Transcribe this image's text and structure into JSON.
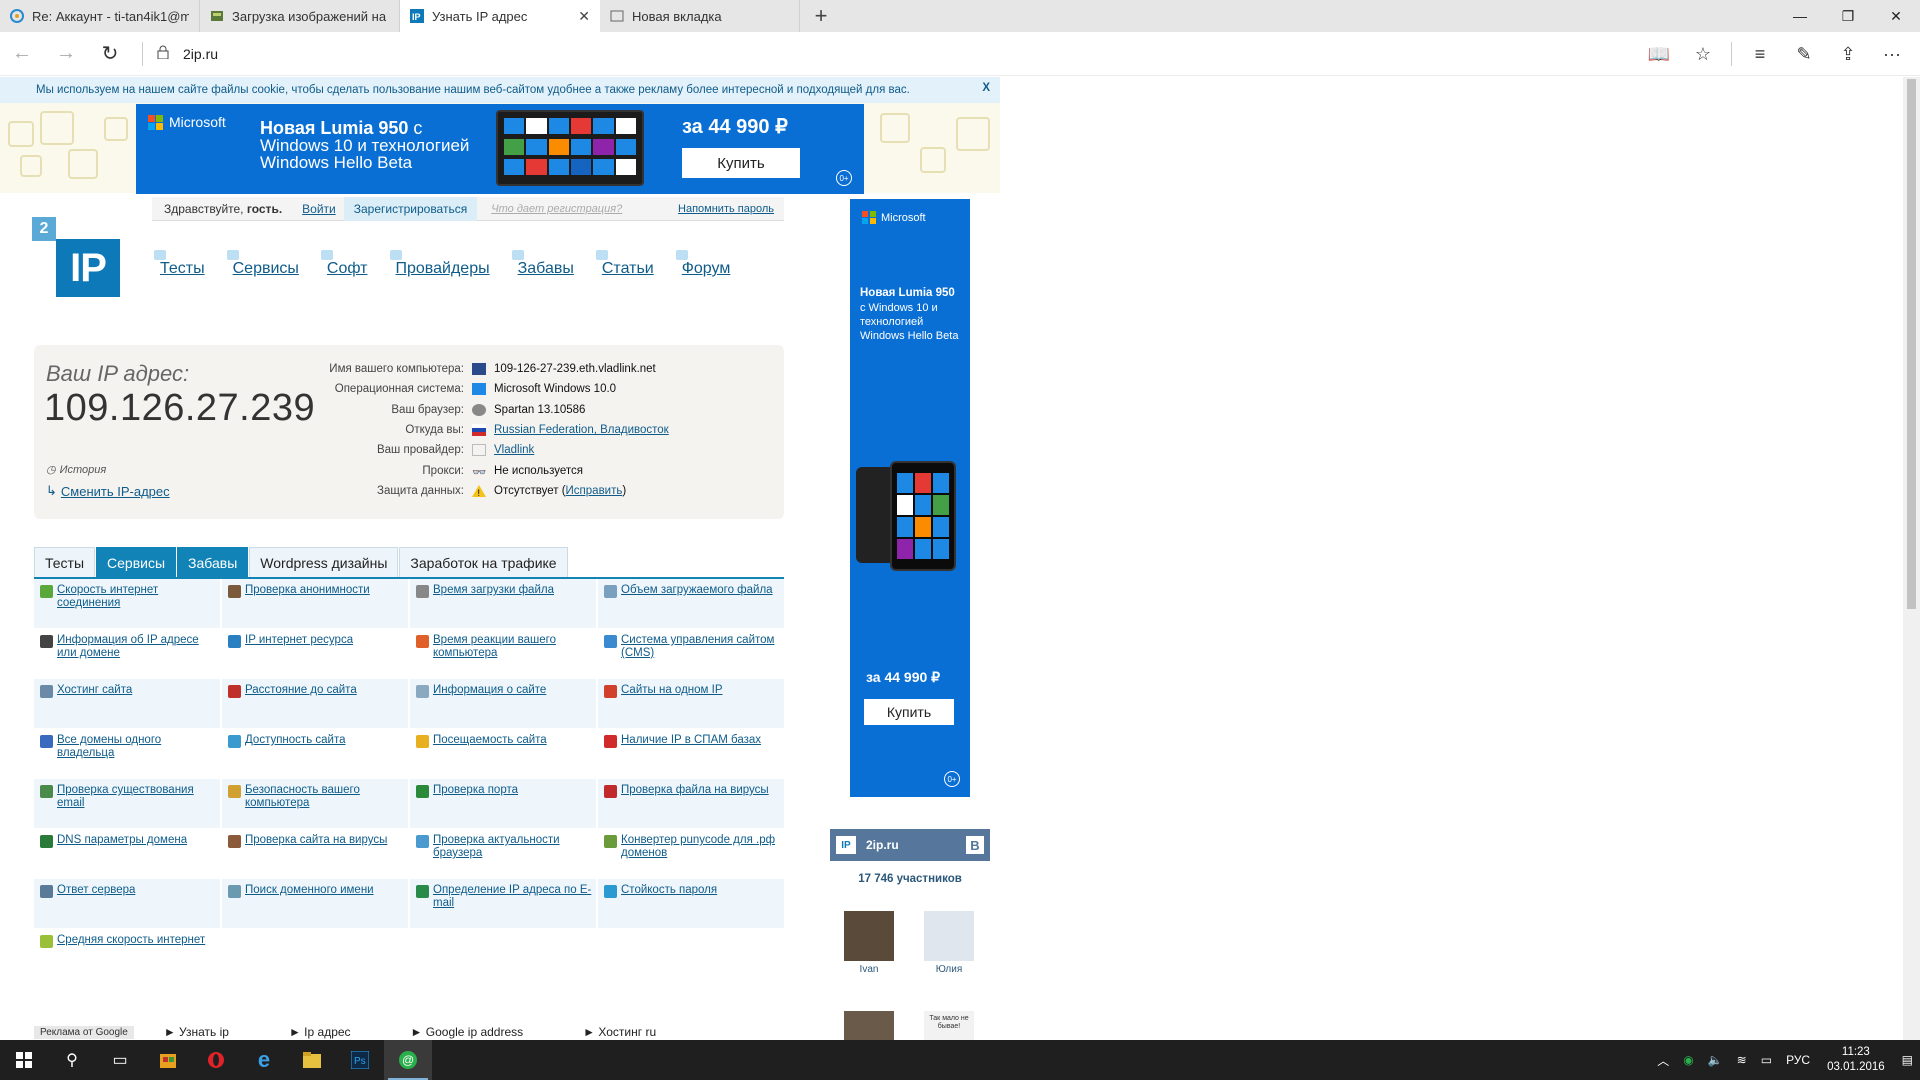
{
  "browser": {
    "tabs": [
      {
        "title": "Re: Аккаунт - ti-tan4ik1@m",
        "icon": "mail-icon"
      },
      {
        "title": "Загрузка изображений на",
        "icon": "image-upload-icon"
      },
      {
        "title": "Узнать IP адрес",
        "icon": "ip-icon",
        "active": true
      },
      {
        "title": "Новая вкладка",
        "icon": "new-tab-icon"
      }
    ],
    "new_tab": "+",
    "url": "2ip.ru"
  },
  "cookie": {
    "text": "Мы используем на нашем сайте файлы cookie, чтобы сделать пользование нашим веб-сайтом удобнее а также рекламу более интересной и подходящей для вас.",
    "close": "X"
  },
  "banner": {
    "brand": "Microsoft",
    "title": "Новая Lumia 950",
    "title_suffix": "с",
    "line2": "Windows 10 и технологией",
    "line3": "Windows Hello Beta",
    "price": "за 44 990 ₽",
    "buy": "Купить",
    "age": "0+"
  },
  "login": {
    "greeting": "Здравствуйте,",
    "guest": "гость.",
    "login": "Войти",
    "register": "Зарегистрироваться",
    "why": "Что дает регистрация?",
    "forgot": "Напомнить пароль"
  },
  "logo": {
    "num": "2",
    "text": "IP"
  },
  "nav": [
    "Тесты",
    "Сервисы",
    "Софт",
    "Провайдеры",
    "Забавы",
    "Статьи",
    "Форум"
  ],
  "ip": {
    "label": "Ваш IP адрес:",
    "address": "109.126.27.239",
    "history": "История",
    "change": "Сменить IP-адрес",
    "rows": [
      {
        "label": "Имя вашего компьютера:",
        "value": "109-126-27-239.eth.vladlink.net",
        "link": false
      },
      {
        "label": "Операционная система:",
        "value": "Microsoft Windows 10.0",
        "link": false
      },
      {
        "label": "Ваш браузер:",
        "value": "Spartan 13.10586",
        "link": false
      },
      {
        "label": "Откуда вы:",
        "value": "Russian Federation, Владивосток",
        "link": true
      },
      {
        "label": "Ваш провайдер:",
        "value": "Vladlink",
        "link": true
      },
      {
        "label": "Прокси:",
        "value": "Не используется",
        "link": false
      },
      {
        "label": "Защита данных:",
        "value": "Отсутствует (",
        "fix": "Исправить",
        "tail": ")",
        "link": false
      }
    ]
  },
  "section_tabs": [
    "Тесты",
    "Сервисы",
    "Забавы",
    "Wordpress дизайны",
    "Заработок на трафике"
  ],
  "services": [
    {
      "text": "Скорость интернет соединения",
      "color": "#5aa83c"
    },
    {
      "text": "Проверка анонимности",
      "color": "#7a5a3a"
    },
    {
      "text": "Время загрузки файла",
      "color": "#888888"
    },
    {
      "text": "Объем загружаемого файла",
      "color": "#7aa0c0"
    },
    {
      "text": "Информация об IP адресе или домене",
      "color": "#444444"
    },
    {
      "text": "IP интернет ресурса",
      "color": "#2a7fc0"
    },
    {
      "text": "Время реакции вашего компьютера",
      "color": "#e0602a"
    },
    {
      "text": "Система управления сайтом (CMS)",
      "color": "#3a8ad0"
    },
    {
      "text": "Хостинг сайта",
      "color": "#6a8aa8"
    },
    {
      "text": "Расстояние до сайта",
      "color": "#c0302a"
    },
    {
      "text": "Информация о сайте",
      "color": "#8aa8c0"
    },
    {
      "text": "Сайты на одном IP",
      "color": "#d0402a"
    },
    {
      "text": "Все домены одного владельца",
      "color": "#3a6ac0"
    },
    {
      "text": "Доступность сайта",
      "color": "#3a9ad0"
    },
    {
      "text": "Посещаемость сайта",
      "color": "#e8b020"
    },
    {
      "text": "Наличие IP в СПАМ базах",
      "color": "#d02a2a"
    },
    {
      "text": "Проверка существования email",
      "color": "#4a8a4a"
    },
    {
      "text": "Безопасность вашего компьютера",
      "color": "#d0a030"
    },
    {
      "text": "Проверка порта",
      "color": "#2a8a3a"
    },
    {
      "text": "Проверка файла на вирусы",
      "color": "#c02a2a"
    },
    {
      "text": "DNS параметры домена",
      "color": "#2a7a3a"
    },
    {
      "text": "Проверка сайта на вирусы",
      "color": "#8a5a3a"
    },
    {
      "text": "Проверка актуальности браузера",
      "color": "#4a9ad0"
    },
    {
      "text": "Конвертер punycode для .рф доменов",
      "color": "#6a9a3a"
    },
    {
      "text": "Ответ сервера",
      "color": "#5a7a9a"
    },
    {
      "text": "Поиск доменного имени",
      "color": "#6a9ab0"
    },
    {
      "text": "Определение IP адреса по E-mail",
      "color": "#2a8a4a"
    },
    {
      "text": "Стойкость пароля",
      "color": "#2a9ad0"
    },
    {
      "text": "Средняя скорость интернет",
      "color": "#9ac03a"
    }
  ],
  "ads": {
    "label": "Реклама от Google",
    "items": [
      "► Узнать ip",
      "► Ip адрес",
      "► Google ip address",
      "► Хостинг ru"
    ]
  },
  "side_ad": {
    "brand": "Microsoft",
    "title": "Новая Lumia 950",
    "body": "с Windows 10 и технологией Windows Hello Beta",
    "price": "за 44 990 ₽",
    "buy": "Купить",
    "age": "0+"
  },
  "vk": {
    "name": "2ip.ru",
    "badge": "В",
    "members": "17 746 участников",
    "people": [
      {
        "name": "Ivan"
      },
      {
        "name": "Юлия"
      }
    ],
    "caption": "Так мало не бывае!"
  },
  "taskbar": {
    "lang": "РУС",
    "time": "11:23",
    "date": "03.01.2016"
  }
}
